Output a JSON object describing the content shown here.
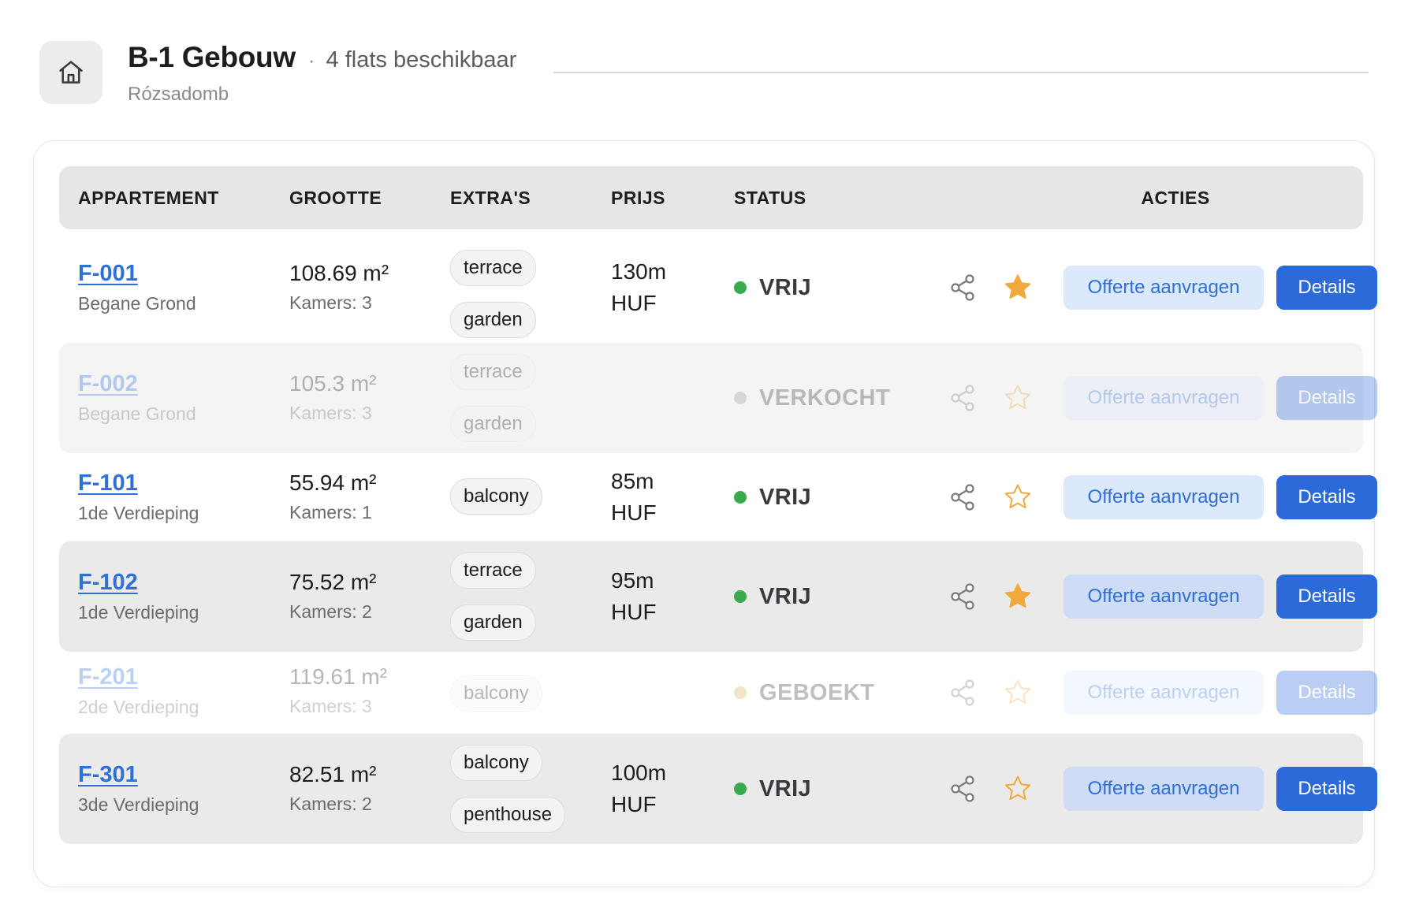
{
  "header": {
    "title": "B-1 Gebouw",
    "separator": "·",
    "flats_available": "4 flats beschikbaar",
    "subtitle": "Rózsadomb",
    "icon": "home-icon"
  },
  "table": {
    "columns": [
      "APPARTEMENT",
      "GROOTTE",
      "EXTRA'S",
      "PRIJS",
      "STATUS",
      "ACTIES"
    ],
    "rows": [
      {
        "id": "F-001",
        "floor": "Begane Grond",
        "size": "108.69 m²",
        "rooms": "Kamers: 3",
        "extras": [
          "terrace",
          "garden"
        ],
        "price": [
          "130m",
          "HUF"
        ],
        "status": "VRIJ",
        "favorite": true,
        "available": true
      },
      {
        "id": "F-002",
        "floor": "Begane Grond",
        "size": "105.3 m²",
        "rooms": "Kamers: 3",
        "extras": [
          "terrace",
          "garden"
        ],
        "price": [],
        "status": "VERKOCHT",
        "favorite": false,
        "available": false
      },
      {
        "id": "F-101",
        "floor": "1de Verdieping",
        "size": "55.94 m²",
        "rooms": "Kamers: 1",
        "extras": [
          "balcony"
        ],
        "price": [
          "85m",
          "HUF"
        ],
        "status": "VRIJ",
        "favorite": false,
        "available": true
      },
      {
        "id": "F-102",
        "floor": "1de Verdieping",
        "size": "75.52 m²",
        "rooms": "Kamers: 2",
        "extras": [
          "terrace",
          "garden"
        ],
        "price": [
          "95m",
          "HUF"
        ],
        "status": "VRIJ",
        "favorite": true,
        "available": true
      },
      {
        "id": "F-201",
        "floor": "2de Verdieping",
        "size": "119.61 m²",
        "rooms": "Kamers: 3",
        "extras": [
          "balcony"
        ],
        "price": [],
        "status": "GEBOEKT",
        "favorite": false,
        "available": false
      },
      {
        "id": "F-301",
        "floor": "3de Verdieping",
        "size": "82.51 m²",
        "rooms": "Kamers: 2",
        "extras": [
          "balcony",
          "penthouse"
        ],
        "price": [
          "100m",
          "HUF"
        ],
        "status": "VRIJ",
        "favorite": false,
        "available": true
      }
    ],
    "actions": {
      "offer_label": "Offerte aanvragen",
      "details_label": "Details"
    }
  },
  "icons": {
    "share": "share-icon",
    "favorite": "star-icon"
  },
  "colors": {
    "accent": "#2a6ad9",
    "link": "#2e6fd8",
    "status_free": "#3aaa4f",
    "status_sold": "#9a9a9a",
    "status_booked": "#d9a95e",
    "star": "#f0a93a"
  }
}
